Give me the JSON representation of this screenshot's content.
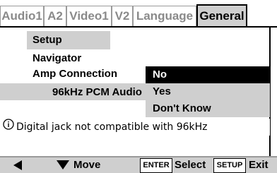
{
  "tabs": [
    "Audio1",
    "A2",
    "Video1",
    "V2",
    "Language",
    "General"
  ],
  "active_tab": "General",
  "section_title": "Setup Navigator",
  "settings": {
    "amp_connection_label": "Amp Connection",
    "pcm_label": "96kHz PCM Audio"
  },
  "options": [
    "No",
    "Yes",
    "Don't Know"
  ],
  "selected_option": "No",
  "info": {
    "icon": "info-circle-icon",
    "text": "Digital jack not compatible with 96kHz"
  },
  "footer": {
    "move_label": "Move",
    "enter_key": "ENTER",
    "select_label": "Select",
    "setup_key": "SETUP",
    "exit_label": "Exit"
  }
}
